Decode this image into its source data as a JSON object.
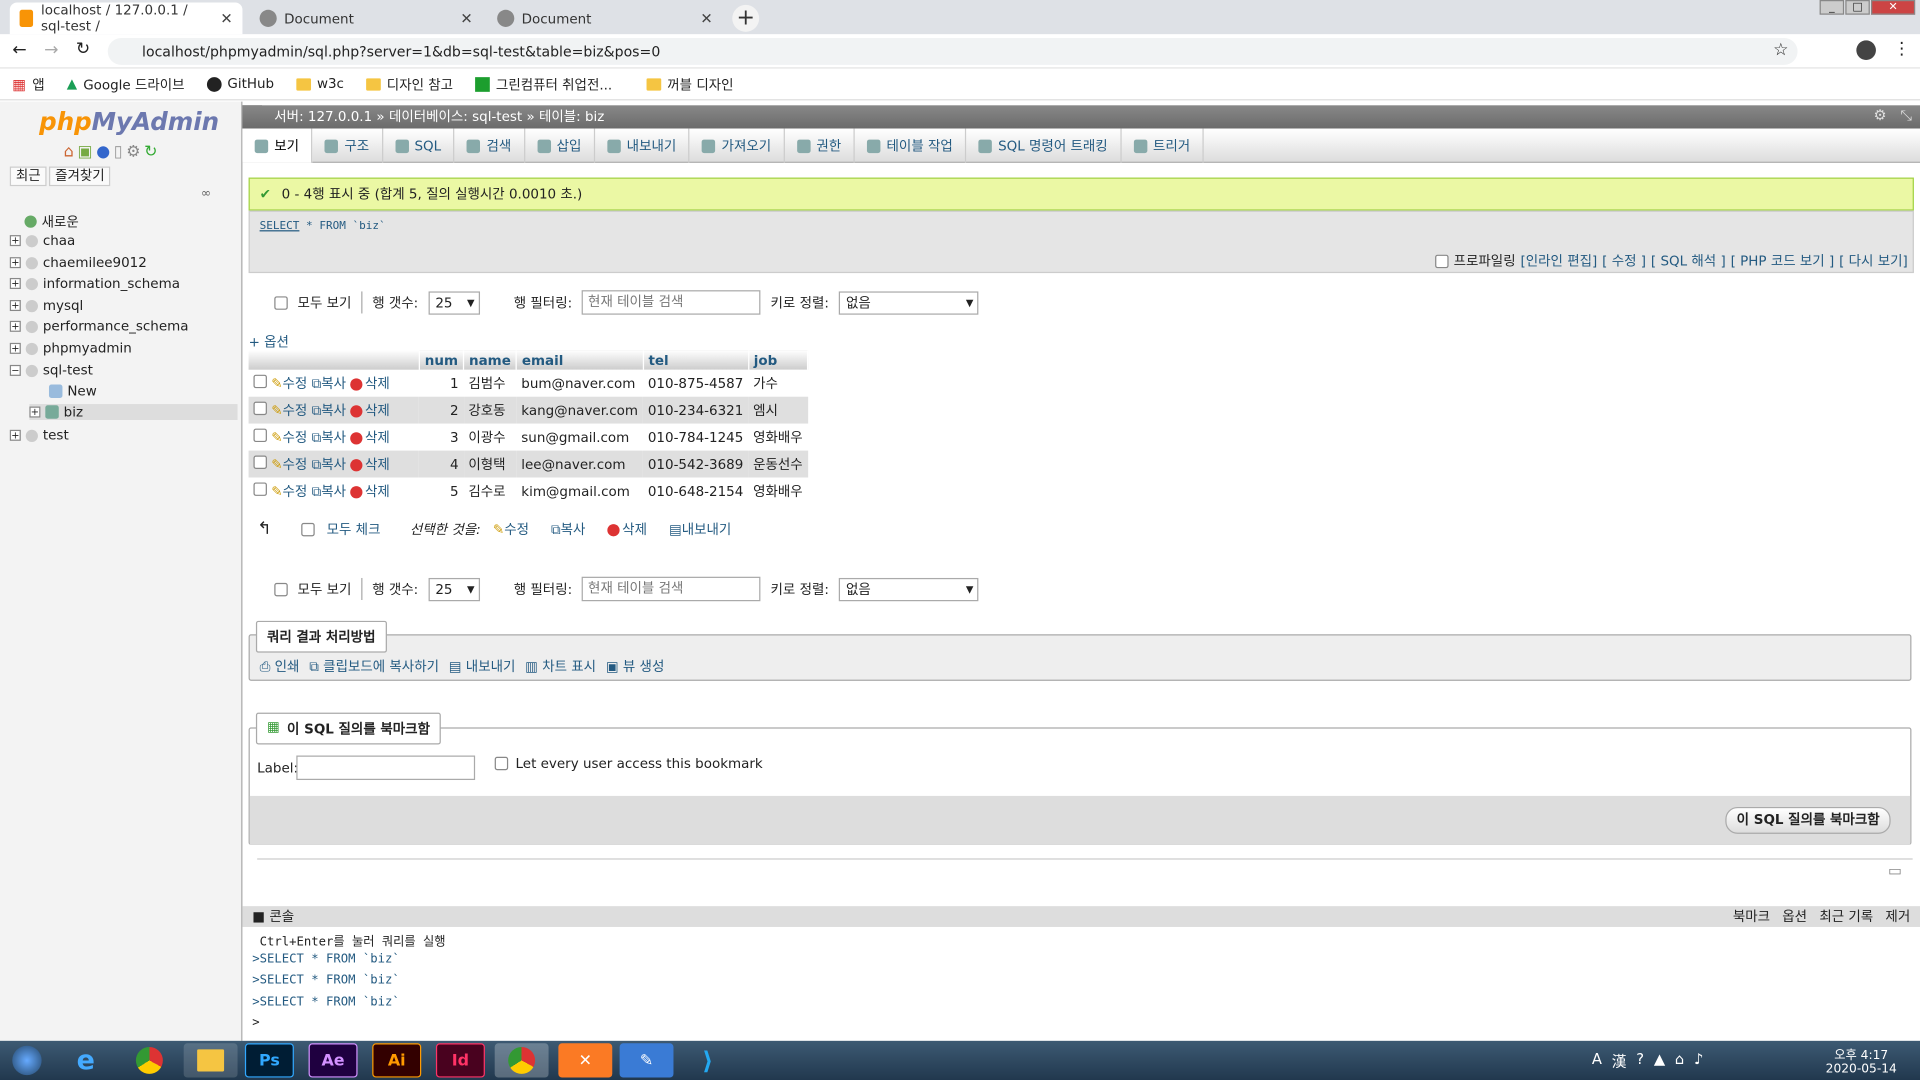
{
  "browser": {
    "tabs": [
      {
        "title": "localhost / 127.0.0.1 / sql-test /",
        "active": true
      },
      {
        "title": "Document",
        "active": false
      },
      {
        "title": "Document",
        "active": false
      }
    ],
    "url": "localhost/phpmyadmin/sql.php?server=1&db=sql-test&table=biz&pos=0",
    "bookmarks": [
      "앱",
      "Google 드라이브",
      "GitHub",
      "w3c",
      "디자인 참고",
      "그린컴퓨터 취업전...",
      "꺼블 디자인"
    ]
  },
  "sidebar": {
    "logo_a": "php",
    "logo_b": "MyAdmin",
    "recent": "최근",
    "favorites": "즐겨찾기",
    "items": [
      "새로운",
      "chaa",
      "chaemilee9012",
      "information_schema",
      "mysql",
      "performance_schema",
      "phpmyadmin",
      "sql-test",
      "New",
      "biz",
      "test"
    ]
  },
  "breadcrumb": "서버: 127.0.0.1 » 데이터베이스: sql-test » 테이블: biz",
  "menu": [
    "보기",
    "구조",
    "SQL",
    "검색",
    "삽입",
    "내보내기",
    "가져오기",
    "권한",
    "테이블 작업",
    "SQL 명령어 트래킹",
    "트리거"
  ],
  "result": {
    "success": "0 - 4행 표시 중 (합계 5, 질의 실행시간 0.0010 초.)",
    "query_kw": "SELECT",
    "query_rest": " * FROM `biz`",
    "tools": [
      "프로파일링",
      "[인라인 편집]",
      "[ 수정 ]",
      "[ SQL 해석 ]",
      "[ PHP 코드 보기 ]",
      "[ 다시 보기]"
    ]
  },
  "nav": {
    "show_all": "모두 보기",
    "rows_label": "행 갯수:",
    "rows_value": "25",
    "filter_label": "행 필터링:",
    "filter_placeholder": "현재 테이블 검색",
    "sort_label": "키로 정렬:",
    "sort_value": "없음"
  },
  "table": {
    "options": "+ 옵션",
    "columns": [
      "num",
      "name",
      "email",
      "tel",
      "job"
    ],
    "edit": "수정",
    "copy": "복사",
    "delete": "삭제",
    "rows": [
      [
        "1",
        "김범수",
        "bum@naver.com",
        "010-875-4587",
        "가수"
      ],
      [
        "2",
        "강호동",
        "kang@naver.com",
        "010-234-6321",
        "엠시"
      ],
      [
        "3",
        "이광수",
        "sun@gmail.com",
        "010-784-1245",
        "영화배우"
      ],
      [
        "4",
        "이형택",
        "lee@naver.com",
        "010-542-3689",
        "운동선수"
      ],
      [
        "5",
        "김수로",
        "kim@gmail.com",
        "010-648-2154",
        "영화배우"
      ]
    ]
  },
  "bulk": {
    "check_all": "모두 체크",
    "with_selected": "선택한 것을:",
    "edit": "수정",
    "copy": "복사",
    "delete": "삭제",
    "export": "내보내기"
  },
  "ops": {
    "legend": "쿼리 결과 처리방법",
    "items": [
      "인쇄",
      "클립보드에 복사하기",
      "내보내기",
      "차트 표시",
      "뷰 생성"
    ]
  },
  "bookmark": {
    "legend": "이 SQL 질의를 북마크함",
    "label": "Label:",
    "share": "Let every user access this bookmark",
    "button": "이 SQL 질의를 북마크함"
  },
  "console": {
    "title": "콘솔",
    "links": [
      "북마크",
      "옵션",
      "최근 기록",
      "제거"
    ],
    "hint": "Ctrl+Enter를 눌러 쿼리를 실행",
    "lines": [
      ">SELECT * FROM `biz`",
      ">SELECT * FROM `biz`",
      ">SELECT * FROM `biz`"
    ],
    "prompt": ">"
  },
  "taskbar": {
    "apps": [
      "Ps",
      "Ae",
      "Ai",
      "Id"
    ],
    "time": "오후 4:17",
    "date": "2020-05-14"
  }
}
